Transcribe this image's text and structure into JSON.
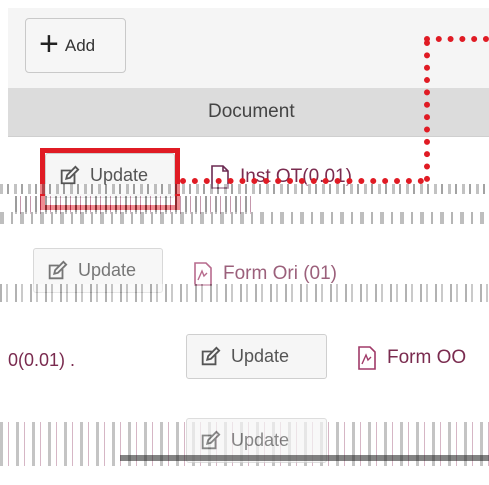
{
  "toolbar": {
    "add_label": "Add"
  },
  "table": {
    "header": "Document",
    "update_label": "Update",
    "rows": [
      {
        "doc": "Inst OT(0.01)"
      },
      {
        "doc": "Form Ori (01)"
      },
      {
        "doc": "Form OO"
      }
    ],
    "row3_prefix": "0(0.01) ."
  },
  "colors": {
    "highlight": "#e01b24",
    "doc_link": "#7a2b4f",
    "header_bg": "#dcdcdc"
  },
  "icons": [
    "plus-icon",
    "edit-icon",
    "document-icon",
    "pdf-icon"
  ]
}
